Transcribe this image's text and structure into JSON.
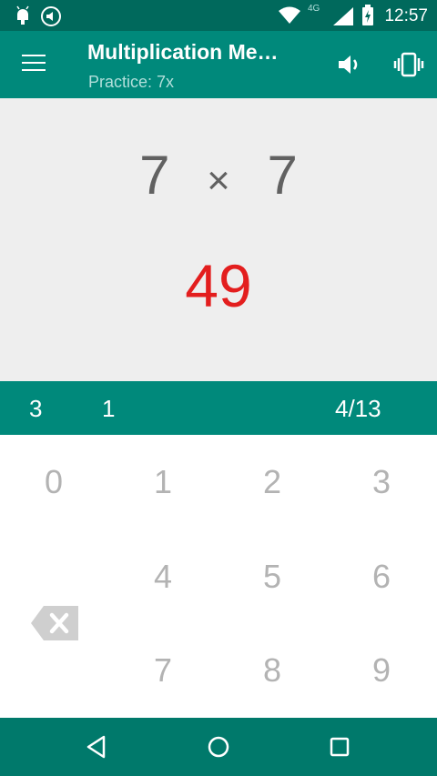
{
  "status_bar": {
    "time": "12:57",
    "network": "4G"
  },
  "app_bar": {
    "title": "Multiplication Me…",
    "subtitle": "Practice: 7x",
    "icons": [
      "menu-icon",
      "volume-icon",
      "vibrate-icon"
    ]
  },
  "problem": {
    "left": "7",
    "operator": "×",
    "right": "7",
    "answer": "49"
  },
  "stats": {
    "left": "3",
    "middle": "1",
    "progress": "4/13"
  },
  "keypad": {
    "keys": [
      "0",
      "1",
      "2",
      "3",
      "4",
      "5",
      "6",
      "7",
      "8",
      "9"
    ],
    "backspace_icon": "backspace-icon"
  },
  "nav_bar": {
    "icons": [
      "back-icon",
      "home-icon",
      "recents-icon"
    ]
  },
  "colors": {
    "status_bar": "#00695c",
    "app_bar": "#00897b",
    "answer": "#e31e1e",
    "problem_bg": "#eeeeee",
    "nav_bar": "#00796b"
  }
}
